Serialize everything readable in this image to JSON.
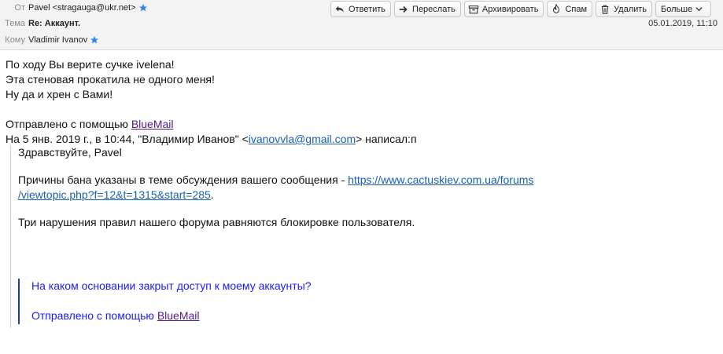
{
  "header": {
    "from_label": "От",
    "from_value": "Pavel <stragauga@ukr.net>",
    "subject_label": "Тема",
    "subject_value": "Re: Аккаунт.",
    "to_label": "Кому",
    "to_value": "Vladimir Ivanov",
    "date": "05.01.2019, 11:10"
  },
  "toolbar": {
    "reply": "Ответить",
    "forward": "Переслать",
    "archive": "Архивировать",
    "spam": "Спам",
    "delete": "Удалить",
    "more": "Больше"
  },
  "message": {
    "line1": "По ходу Вы верите сучке ivelena!",
    "line2": "Эта стеновая прокатила не одного меня!",
    "line3": "Ну да и хрен с Вами!",
    "sent_prefix": "Отправлено с помощью ",
    "sent_link": "BlueMail",
    "reply_header_prefix": "На 5 янв. 2019 г., в 10:44, \"Владимир Иванов\" <",
    "reply_header_email": "ivanovvla@gmail.com",
    "reply_header_suffix": "> написал:п"
  },
  "quote": {
    "greeting": "Здравствуйте, Pavel",
    "reason_prefix": "Причины бана указаны в теме обсуждения вашего сообщения - ",
    "reason_link_1": "https://www.cactuskiev.com.ua/forums",
    "reason_link_2": "/viewtopic.php?f=12&t=1315&start=285",
    "reason_suffix": ".",
    "rule": "Три нарушения правил нашего форума равняются блокировке пользователя.",
    "inner_question": "На каком основании закрыт доступ к моему аккаунты?",
    "inner_sent_prefix": "Отправлено с помощью ",
    "inner_sent_link": "BlueMail"
  },
  "colors": {
    "header_bg": "#f3f3f3",
    "star": "#2f80ed",
    "link_visited": "#551a8b",
    "link_blue": "#1a5fb4",
    "inner_quote_text": "#1a1aff",
    "inner_quote_bar": "#1f3aa8"
  },
  "icons": {
    "reply": "reply-icon",
    "forward": "forward-icon",
    "archive": "archive-icon",
    "spam": "spam-fire-icon",
    "delete": "trash-icon",
    "more": "chevron-down-icon",
    "star": "star-icon"
  }
}
